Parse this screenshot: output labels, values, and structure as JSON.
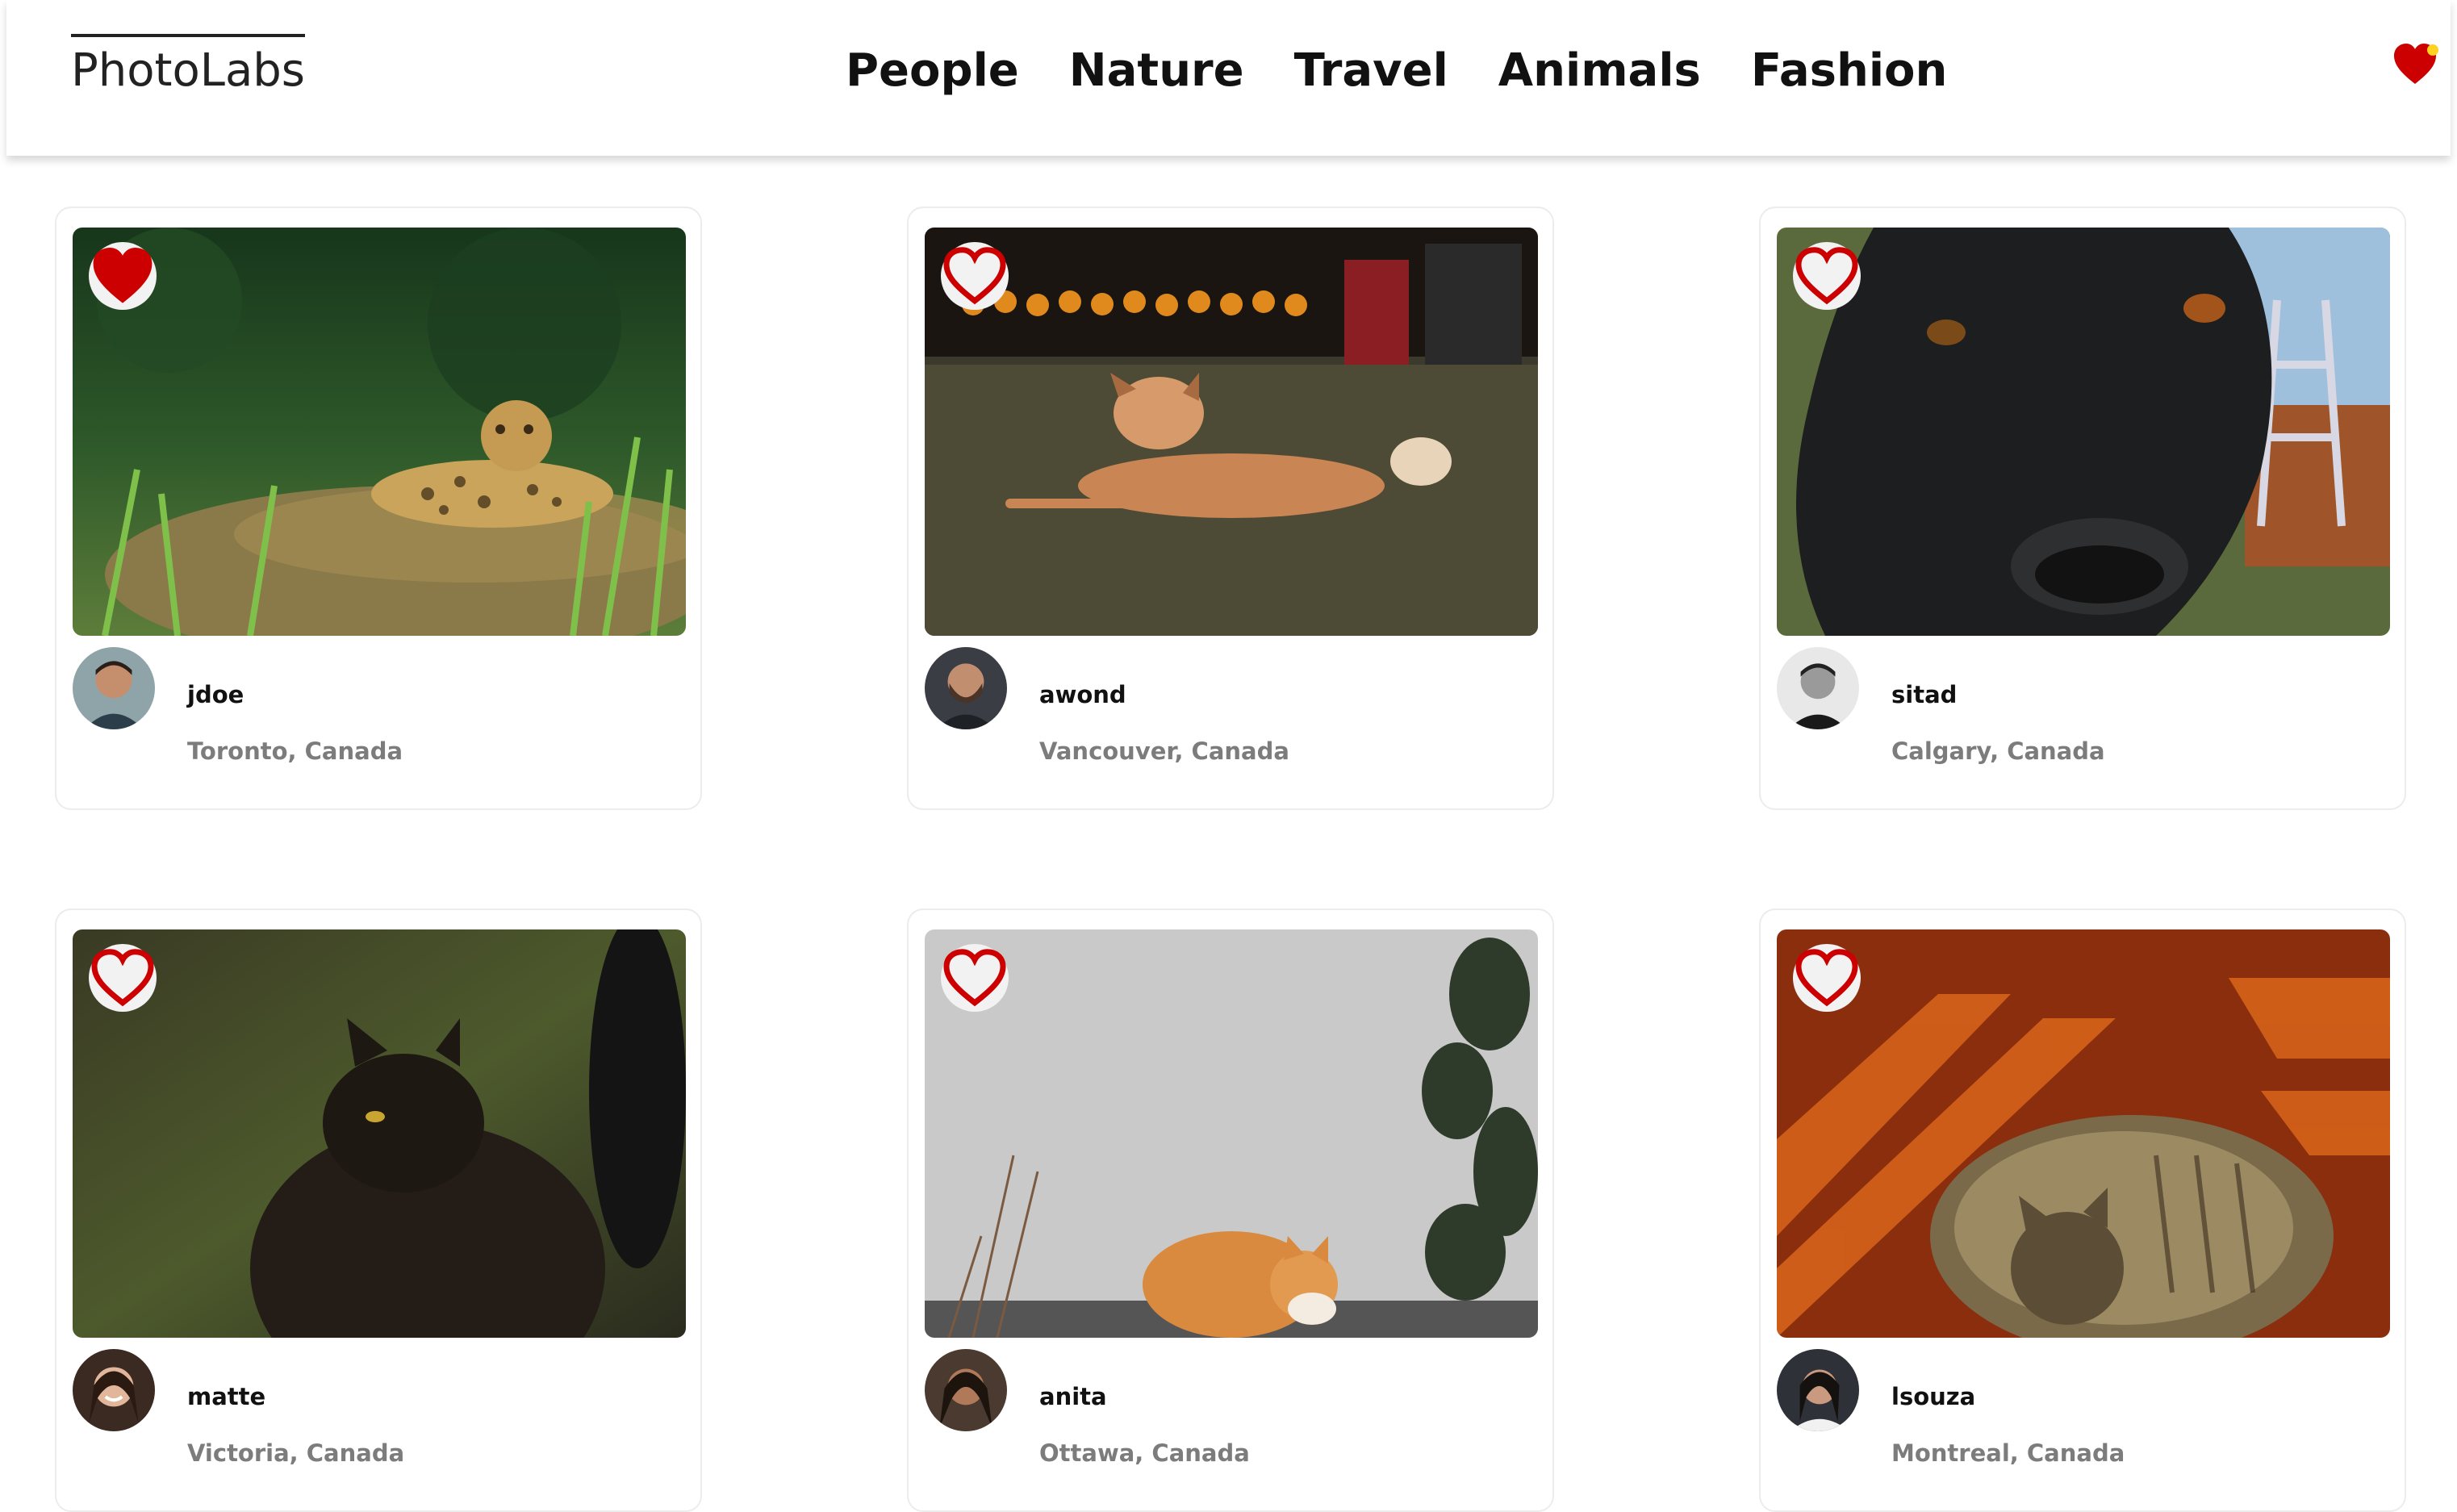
{
  "app": {
    "logo": "PhotoLabs"
  },
  "nav": {
    "topics": [
      "People",
      "Nature",
      "Travel",
      "Animals",
      "Fashion"
    ],
    "favourite_badge": {
      "icon": "heart-icon",
      "has_notification": true
    }
  },
  "colors": {
    "heart_red": "#cc0000",
    "notification_dot": "#ffd21f",
    "card_border": "#ececec",
    "location_text": "#7c7c7c"
  },
  "photos": [
    {
      "username": "jdoe",
      "location": "Toronto, Canada",
      "liked": true,
      "subject": "jaguar-in-grass"
    },
    {
      "username": "awond",
      "location": "Vancouver, Canada",
      "liked": false,
      "subject": "dog-on-lawn"
    },
    {
      "username": "sitad",
      "location": "Calgary, Canada",
      "liked": false,
      "subject": "black-dog-closeup"
    },
    {
      "username": "matte",
      "location": "Victoria, Canada",
      "liked": false,
      "subject": "black-cat"
    },
    {
      "username": "anita",
      "location": "Ottawa, Canada",
      "liked": false,
      "subject": "orange-cat-by-wall"
    },
    {
      "username": "lsouza",
      "location": "Montreal, Canada",
      "liked": false,
      "subject": "tabby-cat-on-rug"
    }
  ]
}
